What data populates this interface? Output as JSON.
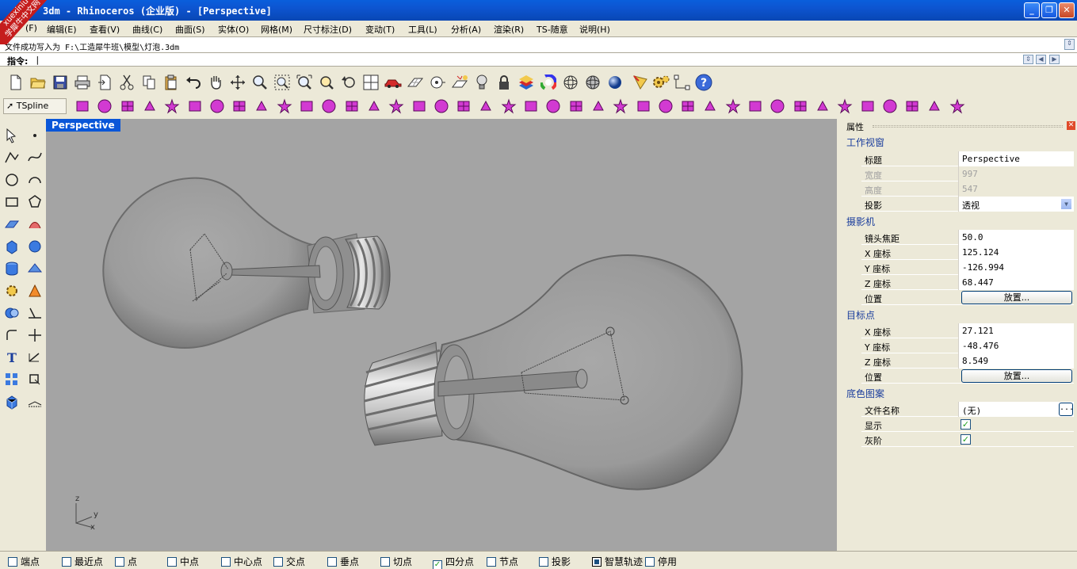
{
  "window": {
    "title": "3dm - Rhinoceros (企业版) - [Perspective]",
    "watermark_brand": "xuexiniu",
    "watermark_text": "学犀牛中文网",
    "min_glyph": "_",
    "max_glyph": "❐",
    "close_glyph": "✕"
  },
  "menu": [
    "(F)",
    "编辑(E)",
    "查看(V)",
    "曲线(C)",
    "曲面(S)",
    "实体(O)",
    "网格(M)",
    "尺寸标注(D)",
    "变动(T)",
    "工具(L)",
    "分析(A)",
    "渲染(R)",
    "TS-随意",
    "说明(H)"
  ],
  "history_text": "文件成功写入为 F:\\工造犀牛班\\模型\\灯泡.3dm",
  "command": {
    "label": "指令:",
    "value": "|"
  },
  "toolbar2_tab": "TSpline",
  "viewport": {
    "title": "Perspective",
    "axis_labels": {
      "z": "z",
      "y": "y",
      "x": "x"
    }
  },
  "panel": {
    "title": "属性",
    "close_glyph": "✕",
    "sections": {
      "viewport": "工作视窗",
      "camera": "摄影机",
      "target": "目标点",
      "background": "底色图案"
    },
    "rows": {
      "title": {
        "k": "标题",
        "v": "Perspective"
      },
      "width": {
        "k": "宽度",
        "v": "997"
      },
      "height": {
        "k": "高度",
        "v": "547"
      },
      "projection": {
        "k": "投影",
        "v": "透视"
      },
      "lens": {
        "k": "镜头焦距",
        "v": "50.0"
      },
      "cam_x": {
        "k": "X 座标",
        "v": "125.124"
      },
      "cam_y": {
        "k": "Y 座标",
        "v": "-126.994"
      },
      "cam_z": {
        "k": "Z 座标",
        "v": "68.447"
      },
      "cam_pos": {
        "k": "位置",
        "btn": "放置..."
      },
      "tgt_x": {
        "k": "X 座标",
        "v": "27.121"
      },
      "tgt_y": {
        "k": "Y 座标",
        "v": "-48.476"
      },
      "tgt_z": {
        "k": "Z 座标",
        "v": "8.549"
      },
      "tgt_pos": {
        "k": "位置",
        "btn": "放置..."
      },
      "filename": {
        "k": "文件名称",
        "v": "(无)",
        "btn": "..."
      },
      "show": {
        "k": "显示",
        "checked": true
      },
      "gray": {
        "k": "灰阶",
        "checked": true
      }
    }
  },
  "osnaps": [
    {
      "label": "端点",
      "checked": false
    },
    {
      "label": "最近点",
      "checked": false
    },
    {
      "label": "点",
      "checked": false
    },
    {
      "label": "中点",
      "checked": false
    },
    {
      "label": "中心点",
      "checked": false
    },
    {
      "label": "交点",
      "checked": false
    },
    {
      "label": "垂点",
      "checked": false
    },
    {
      "label": "切点",
      "checked": false
    },
    {
      "label": "四分点",
      "checked": true
    },
    {
      "label": "节点",
      "checked": false
    },
    {
      "label": "投影",
      "checked": false
    },
    {
      "label": "智慧轨迹",
      "checked": true
    },
    {
      "label": "停用",
      "checked": false
    }
  ],
  "colors": {
    "title_blue": "#0a5fdc",
    "viewport_bg": "#a4a4a4",
    "section_blue": "#1a3d9c",
    "tspline_magenta": "#d23ad2"
  }
}
